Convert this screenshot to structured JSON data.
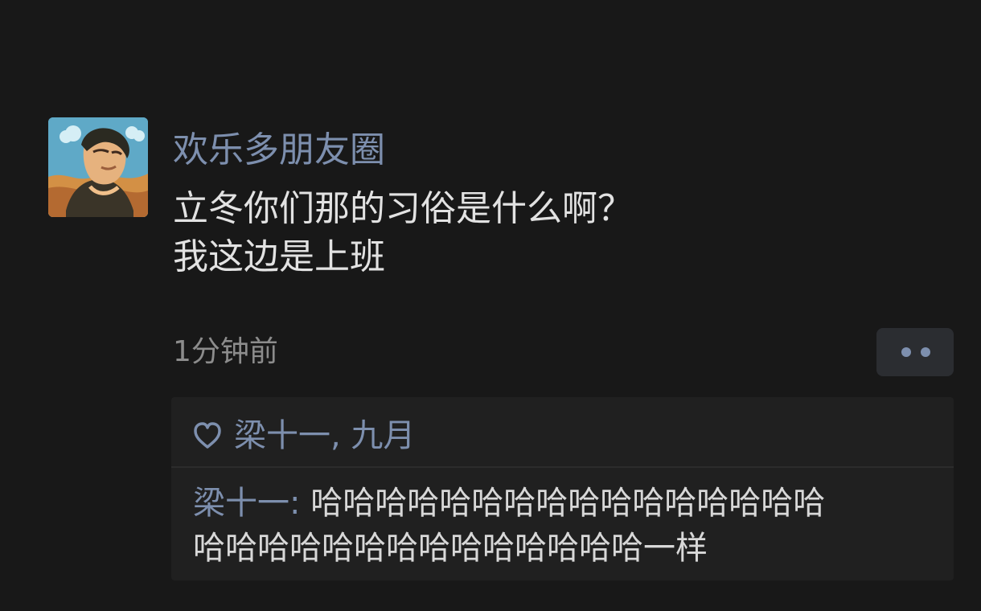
{
  "post": {
    "author": "欢乐多朋友圈",
    "lines": [
      "立冬你们那的习俗是什么啊？",
      "我这边是上班"
    ],
    "time": "1分钟前"
  },
  "interactions": {
    "likes": "梁十一, 九月",
    "comment": {
      "author": "梁十一:",
      "lines": [
        " 哈哈哈哈哈哈哈哈哈哈哈哈哈哈哈哈",
        "哈哈哈哈哈哈哈哈哈哈哈哈哈哈一样"
      ]
    }
  },
  "icons": {
    "avatar": "illustrated-profile-avatar",
    "more": "two-dots-more-icon",
    "like": "heart-outline-icon"
  },
  "colors": {
    "background": "#181818",
    "link_blue": "#7d8fae",
    "text": "#e2e2e2",
    "muted": "#8c8c8c",
    "panel": "#202020"
  }
}
